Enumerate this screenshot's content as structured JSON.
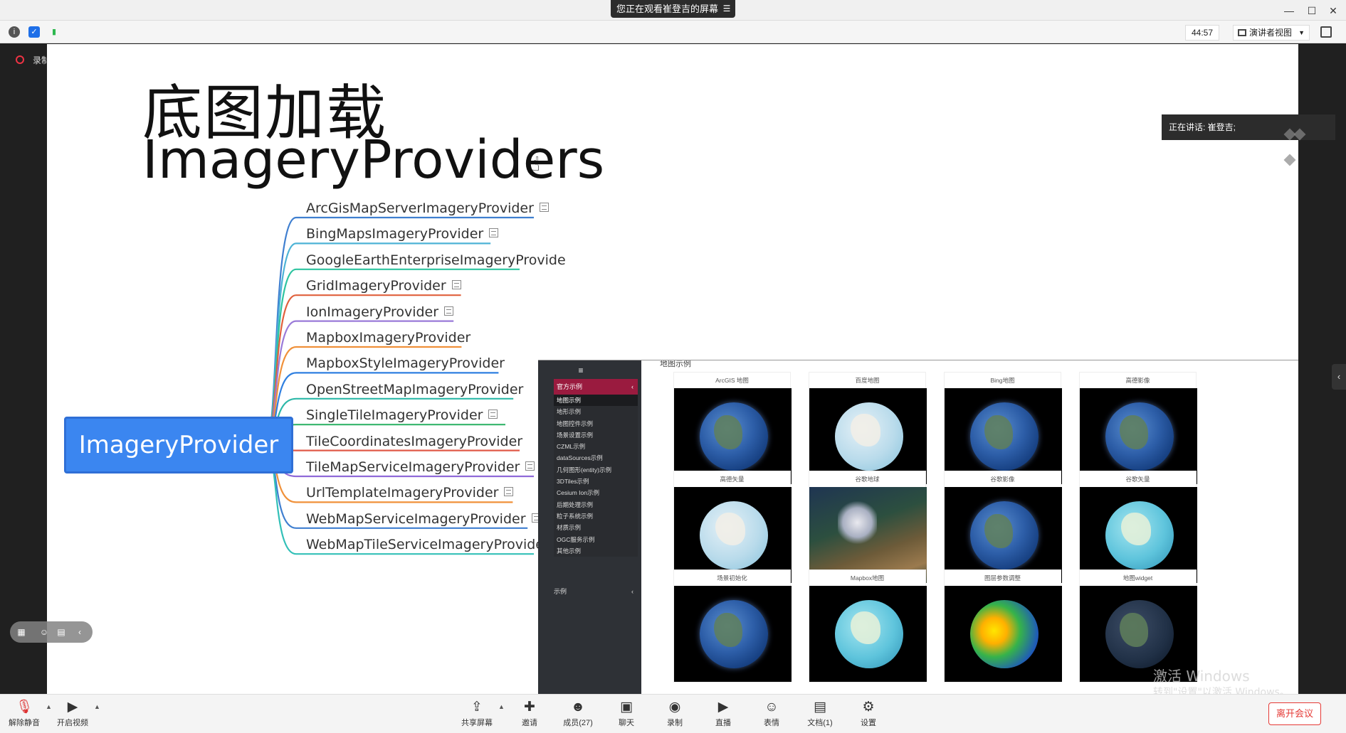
{
  "titlebar": {
    "share_banner": "您正在观看崔登吉的屏幕",
    "controls": [
      "—",
      "☐",
      "✕"
    ]
  },
  "infobar": {
    "timer": "44:57",
    "view_mode": "演讲者视图"
  },
  "recording": {
    "label": "录制中"
  },
  "slide": {
    "title_cn": "底图加载",
    "title_en": "ImageryProviders",
    "mindmap": {
      "root": "ImageryProvider",
      "leaves": [
        {
          "label": "ArcGisMapServerImageryProvider",
          "note": true
        },
        {
          "label": "BingMapsImageryProvider",
          "note": true
        },
        {
          "label": "GoogleEarthEnterpriseImageryProvide",
          "note": false
        },
        {
          "label": "GridImageryProvider",
          "note": true
        },
        {
          "label": "IonImageryProvider",
          "note": true
        },
        {
          "label": "MapboxImageryProvider",
          "note": false
        },
        {
          "label": "MapboxStyleImageryProvider",
          "note": false
        },
        {
          "label": "OpenStreetMapImageryProvider",
          "note": false
        },
        {
          "label": "SingleTileImageryProvider",
          "note": true
        },
        {
          "label": "TileCoordinatesImageryProvider",
          "note": false
        },
        {
          "label": "TileMapServiceImageryProvider",
          "note": true
        },
        {
          "label": "UrlTemplateImageryProvider",
          "note": true
        },
        {
          "label": "WebMapServiceImageryProvider",
          "note": true
        },
        {
          "label": "WebMapTileServiceImageryProvider",
          "note": true
        }
      ],
      "branch_colors": [
        "#3f7fd0",
        "#4db3d6",
        "#2ec4a0",
        "#e0603c",
        "#9a7ad8",
        "#f0913a",
        "#2f7fe0",
        "#2cb8a8",
        "#34b46a",
        "#e05a48",
        "#8f6ad8",
        "#f0913a",
        "#3f7fd0",
        "#33c0b8"
      ]
    }
  },
  "web_demo": {
    "hamburger": "≡",
    "section": "官方示例",
    "items": [
      "地图示例",
      "地形示例",
      "地图控件示例",
      "场景设置示例",
      "CZML示例",
      "dataSources示例",
      "几何图形(entity)示例",
      "3DTiles示例",
      "Cesium Ion示例",
      "后期处理示例",
      "粒子系统示例",
      "材质示例",
      "OGC服务示例",
      "其他示例"
    ],
    "bottom_section": "示例",
    "heading": "地图示例",
    "cards": [
      {
        "title": "ArcGIS 地图",
        "globe": "blue"
      },
      {
        "title": "百度地图",
        "globe": "light"
      },
      {
        "title": "Bing地图",
        "globe": "blue"
      },
      {
        "title": "高德影像",
        "globe": "blue"
      },
      {
        "title": "高德矢量",
        "globe": "light"
      },
      {
        "title": "谷歌地球",
        "globe": "sat"
      },
      {
        "title": "谷歌影像",
        "globe": "blue"
      },
      {
        "title": "谷歌矢量",
        "globe": "teal"
      },
      {
        "title": "场景初始化",
        "globe": "blue"
      },
      {
        "title": "Mapbox地图",
        "globe": "teal"
      },
      {
        "title": "图层参数调整",
        "globe": "heat"
      },
      {
        "title": "地图widget",
        "globe": "dark"
      }
    ]
  },
  "watermark": {
    "line1": "激活 Windows",
    "line2": "转到\"设置\"以激活 Windows。"
  },
  "speaker": {
    "label": "正在讲话: 崔登吉;"
  },
  "toolbar": {
    "unmute": "解除静音",
    "video": "开启视频",
    "share": "共享屏幕",
    "invite": "邀请",
    "members": "成员(27)",
    "chat": "聊天",
    "record": "录制",
    "live": "直播",
    "emoji": "表情",
    "docs": "文档(1)",
    "settings": "设置",
    "leave": "离开会议"
  }
}
